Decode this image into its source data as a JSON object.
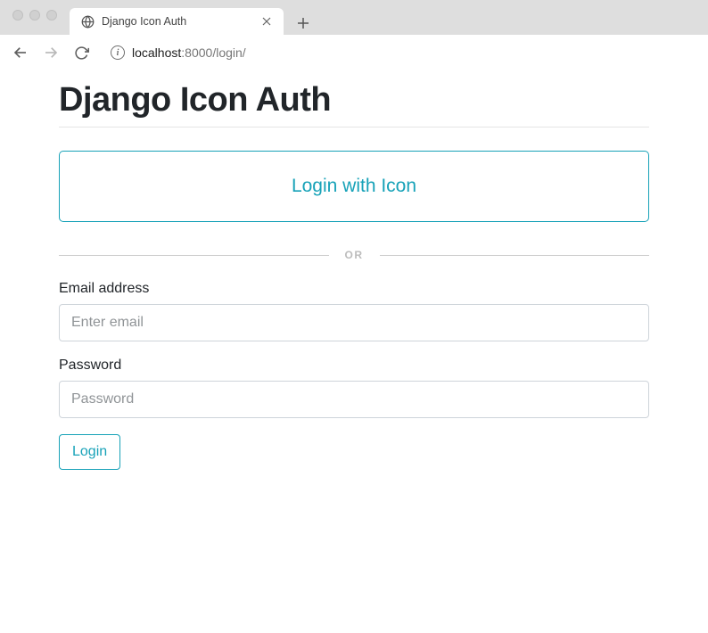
{
  "browser": {
    "tab_title": "Django Icon Auth",
    "url_host": "localhost",
    "url_port": ":8000",
    "url_path": "/login/"
  },
  "page": {
    "title": "Django Icon Auth",
    "login_with_icon_label": "Login with Icon",
    "divider_text": "OR",
    "email_label": "Email address",
    "email_placeholder": "Enter email",
    "password_label": "Password",
    "password_placeholder": "Password",
    "login_button_label": "Login"
  }
}
